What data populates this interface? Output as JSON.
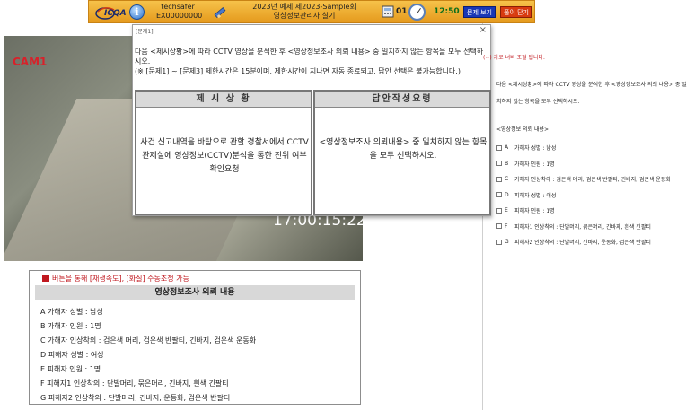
{
  "topbar": {
    "logo_text": "ICQA",
    "user_name": "techsafer",
    "user_id": "EX00000000",
    "exam_line1": "2023년 예제 제2023-Sample회",
    "exam_line2": "영상정보관리사 실기",
    "question_count": "01",
    "time": "12:50",
    "view_button": "문제 보기",
    "close_button": "풀이 닫기"
  },
  "video": {
    "cam_label": "CAM1",
    "timestamp": "17:00:15:22"
  },
  "info_box": {
    "hint": "버튼을 통해 [재생속도], [화질] 수동조정 가능",
    "header": "영상정보조사 의뢰 내용",
    "items": [
      "A 가해자 성별 : 남성",
      "B 가해자 인원 : 1명",
      "C 가해자 인상착의 : 검은색 머리, 검은색 반팔티, 긴바지, 검은색 운동화",
      "D 피해자 성별 : 여성",
      "E 피해자 인원 : 1명",
      "F 피해자1 인상착의 : 단발머리, 묶은머리, 긴바지, 흰색 긴팔티",
      "G 피해자2 인상착의 : 단발머리, 긴바지, 운동화, 검은색 반팔티"
    ]
  },
  "dialog": {
    "title": "[문제1]",
    "close": "×",
    "text_line1": "다음 <제시상황>에 따라 CCTV 영상을 분석한 후 <영상정보조사 의뢰 내용> 중 일치하지 않는 항목을 모두 선택하시오.",
    "text_line2": "(※ [문제1] ~ [문제3] 제한시간은 15분이며, 제한시간이 지나면 자동 종료되고, 답안 선택은 불가능합니다.)",
    "left_head": "제 시 상 황",
    "left_body": "사건 신고내역을 바탕으로 관할 경찰서에서 CCTV 관제실에 영상정보(CCTV)분석을 통한 진위 여부 확인요청",
    "right_head": "답안작성요령",
    "right_body": "<영상정보조사 의뢰내용> 중 일치하지 않는 항목을 모두 선택하시오."
  },
  "right": {
    "top_note": "(~) 가로 너비 조절 됩니다.",
    "intro": "다음 <제시상황>에 따라 CCTV 영상을 분석한 후 <영상정보조사 의뢰 내용> 중 일치하지 않는 항목을 모두 선택하시오.",
    "subtitle": "<영상정보 의뢰 내용>",
    "options": [
      {
        "key": "A",
        "text": "가해자 성별 : 남성"
      },
      {
        "key": "B",
        "text": "가해자 인원 : 1명"
      },
      {
        "key": "C",
        "text": "가해자 인상착의 : 검은색 머리, 검은색 반팔티, 긴바지, 검은색 운동화"
      },
      {
        "key": "D",
        "text": "피해자 성별 : 여성"
      },
      {
        "key": "E",
        "text": "피해자 인원 : 1명"
      },
      {
        "key": "F",
        "text": "피해자1 인상착의 : 단발머리, 묶은머리, 긴바지, 흰색 긴팔티"
      },
      {
        "key": "G",
        "text": "피해자2 인상착의 : 단발머리, 긴바지, 운동화, 검은색 반팔티"
      }
    ]
  },
  "colors": {
    "topbar": "#e59a1d",
    "view_button": "#1937b5",
    "close_button": "#d83a10",
    "hint": "#c0181f",
    "time": "#0c6e1a"
  }
}
